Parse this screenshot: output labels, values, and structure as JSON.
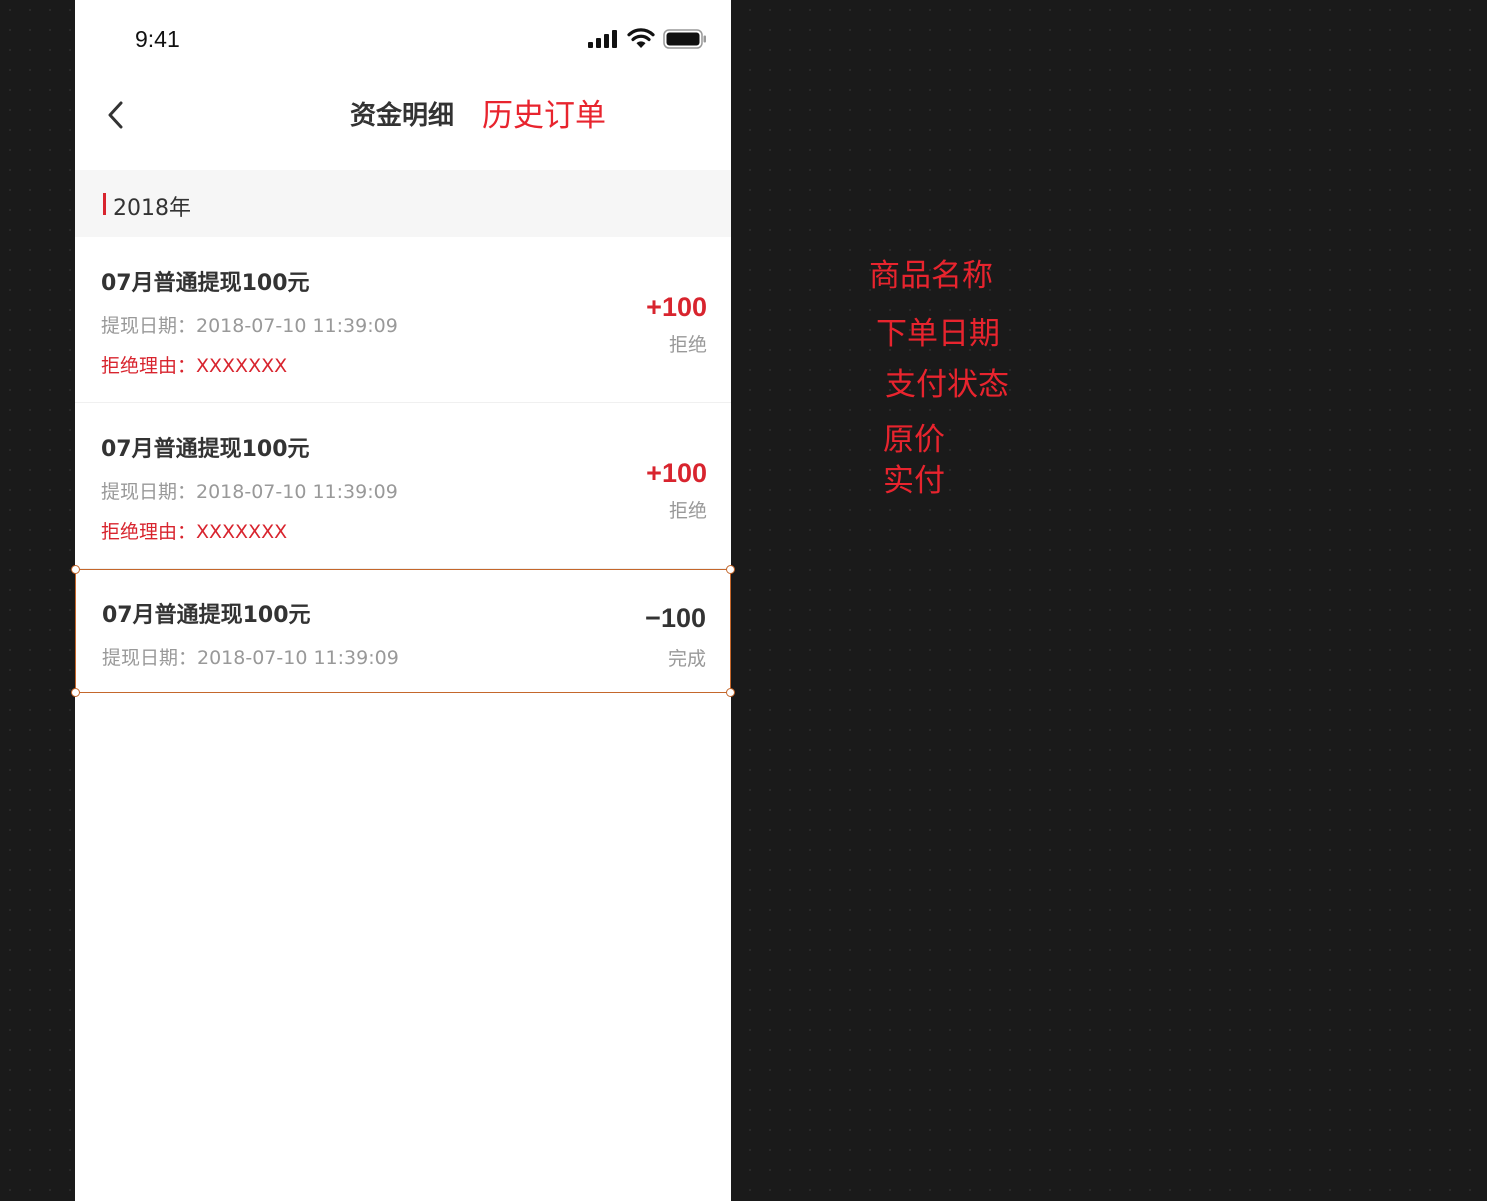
{
  "status_bar": {
    "time": "9:41"
  },
  "nav": {
    "title": "资金明细",
    "title_alt": "历史订单"
  },
  "year_header": {
    "label": "2018年"
  },
  "records": [
    {
      "title": "07月普通提现100元",
      "date": "提现日期：2018-07-10 11:39:09",
      "reason": "拒绝理由：XXXXXXX",
      "amount": "+100",
      "status": "拒绝"
    },
    {
      "title": "07月普通提现100元",
      "date": "提现日期：2018-07-10 11:39:09",
      "reason": "拒绝理由：XXXXXXX",
      "amount": "+100",
      "status": "拒绝"
    },
    {
      "title": "07月普通提现100元",
      "date": "提现日期：2018-07-10 11:39:09",
      "amount": "−100",
      "status": "完成"
    }
  ],
  "annotations": [
    "商品名称",
    "下单日期",
    "支付状态",
    "原价",
    "实付"
  ],
  "colors": {
    "accent": "#d8242e",
    "annotation": "#e8242e",
    "selection": "#c4672c",
    "canvas": "#1a1a1a"
  }
}
